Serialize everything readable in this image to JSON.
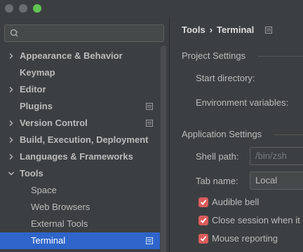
{
  "window": {
    "traffic_lights": [
      "close",
      "minimize",
      "zoom"
    ]
  },
  "search": {
    "value": "",
    "placeholder": ""
  },
  "sidebar": {
    "items": [
      {
        "label": "Appearance & Behavior",
        "expandable": true,
        "expanded": false,
        "bold": true,
        "project_icon": false
      },
      {
        "label": "Keymap",
        "expandable": false,
        "bold": true,
        "project_icon": false
      },
      {
        "label": "Editor",
        "expandable": true,
        "expanded": false,
        "bold": true,
        "project_icon": false
      },
      {
        "label": "Plugins",
        "expandable": false,
        "bold": true,
        "project_icon": true
      },
      {
        "label": "Version Control",
        "expandable": true,
        "expanded": false,
        "bold": true,
        "project_icon": true
      },
      {
        "label": "Build, Execution, Deployment",
        "expandable": true,
        "expanded": false,
        "bold": true,
        "project_icon": false
      },
      {
        "label": "Languages & Frameworks",
        "expandable": true,
        "expanded": false,
        "bold": true,
        "project_icon": false
      },
      {
        "label": "Tools",
        "expandable": true,
        "expanded": true,
        "bold": true,
        "project_icon": false
      },
      {
        "label": "Space",
        "expandable": false,
        "bold": false,
        "project_icon": false,
        "child": true
      },
      {
        "label": "Web Browsers",
        "expandable": false,
        "bold": false,
        "project_icon": false,
        "child": true
      },
      {
        "label": "External Tools",
        "expandable": false,
        "bold": false,
        "project_icon": false,
        "child": true
      },
      {
        "label": "Terminal",
        "expandable": false,
        "bold": false,
        "project_icon": true,
        "child": true,
        "selected": true
      }
    ]
  },
  "breadcrumb": {
    "parent": "Tools",
    "separator": "›",
    "current": "Terminal"
  },
  "project_settings": {
    "title": "Project Settings",
    "start_directory_label": "Start directory:",
    "environment_variables_label": "Environment variables:"
  },
  "application_settings": {
    "title": "Application Settings",
    "shell_path_label": "Shell path:",
    "shell_path_value": "/bin/zsh",
    "tab_name_label": "Tab name:",
    "tab_name_value": "Local",
    "audible_bell_label": "Audible bell",
    "audible_bell_checked": true,
    "close_session_label": "Close session when it",
    "close_session_checked": true,
    "mouse_reporting_label": "Mouse reporting",
    "mouse_reporting_checked": true
  },
  "colors": {
    "background": "#3c3f41",
    "selection": "#2f65ca",
    "checkbox": "#d95c5c",
    "zoom_button": "#61c554"
  }
}
